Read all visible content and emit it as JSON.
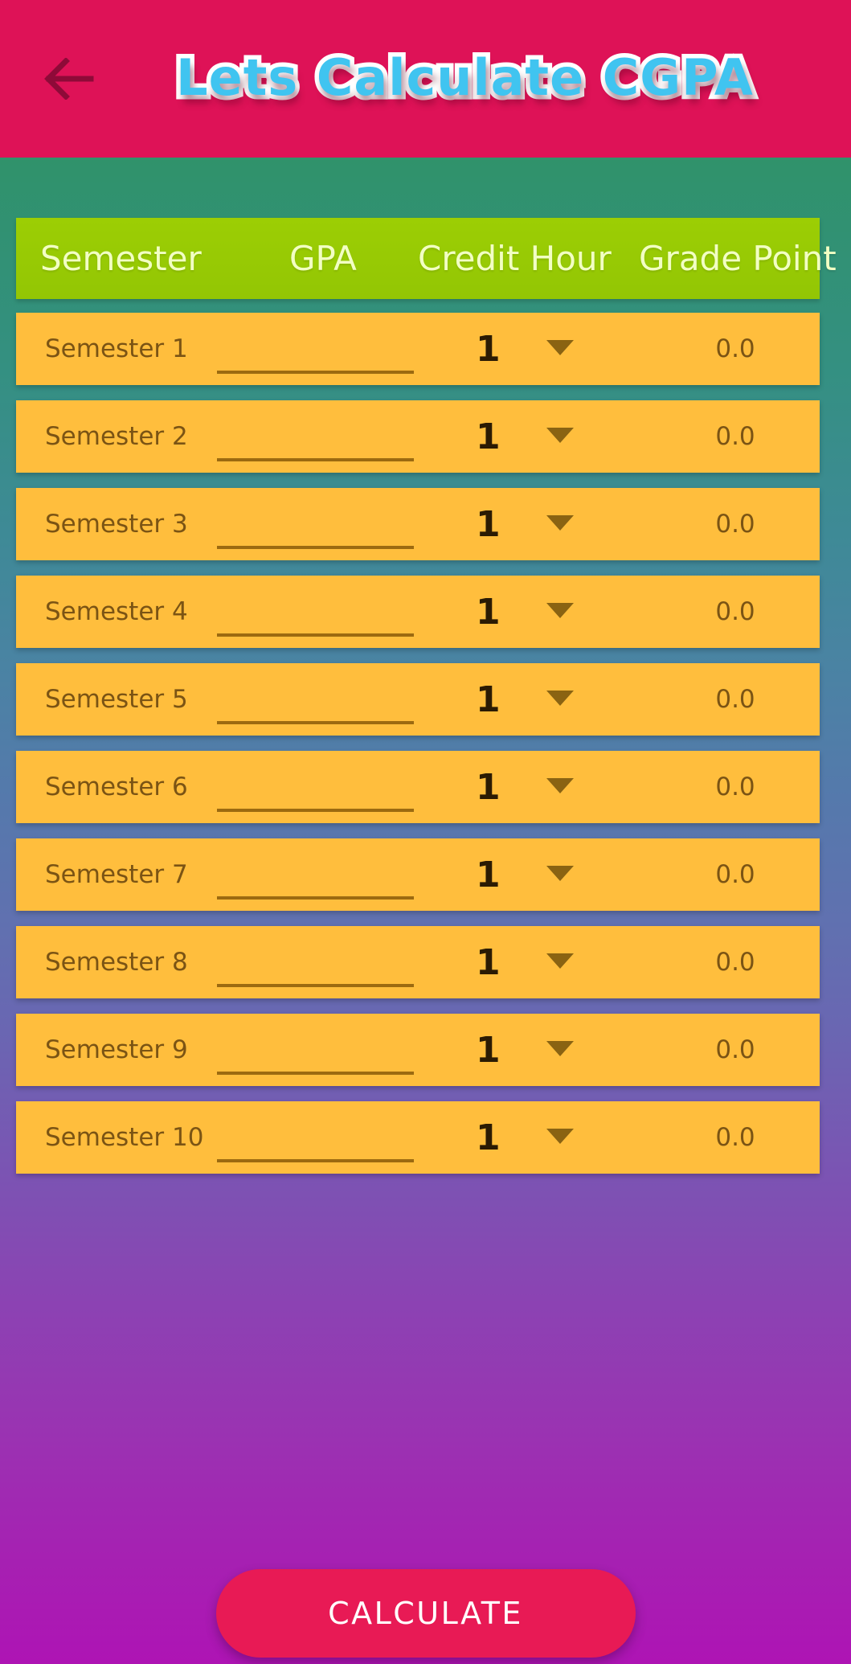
{
  "appbar": {
    "back_icon": "back-arrow-icon",
    "title": "Lets Calculate CGPA",
    "background_color": "#DE1257",
    "title_color": "#40C4F0",
    "title_outline_color": "#FFFFFF"
  },
  "table": {
    "header_background_color": "#9CCE04",
    "header_text_color": "#F2FFC4",
    "row_background_color": "#FFBE3D",
    "columns": [
      {
        "key": "semester",
        "label": "Semester"
      },
      {
        "key": "gpa",
        "label": "GPA"
      },
      {
        "key": "credit_hour",
        "label": "Credit Hour"
      },
      {
        "key": "grade_point",
        "label": "Grade Point"
      }
    ],
    "rows": [
      {
        "semester": "Semester 1",
        "gpa_value": "",
        "gpa_placeholder": "",
        "credit_hour": "1",
        "grade_point": "0.0"
      },
      {
        "semester": "Semester 2",
        "gpa_value": "",
        "gpa_placeholder": "",
        "credit_hour": "1",
        "grade_point": "0.0"
      },
      {
        "semester": "Semester 3",
        "gpa_value": "",
        "gpa_placeholder": "",
        "credit_hour": "1",
        "grade_point": "0.0"
      },
      {
        "semester": "Semester 4",
        "gpa_value": "",
        "gpa_placeholder": "",
        "credit_hour": "1",
        "grade_point": "0.0"
      },
      {
        "semester": "Semester 5",
        "gpa_value": "",
        "gpa_placeholder": "",
        "credit_hour": "1",
        "grade_point": "0.0"
      },
      {
        "semester": "Semester 6",
        "gpa_value": "",
        "gpa_placeholder": "",
        "credit_hour": "1",
        "grade_point": "0.0"
      },
      {
        "semester": "Semester 7",
        "gpa_value": "",
        "gpa_placeholder": "",
        "credit_hour": "1",
        "grade_point": "0.0"
      },
      {
        "semester": "Semester 8",
        "gpa_value": "",
        "gpa_placeholder": "",
        "credit_hour": "1",
        "grade_point": "0.0"
      },
      {
        "semester": "Semester 9",
        "gpa_value": "",
        "gpa_placeholder": "",
        "credit_hour": "1",
        "grade_point": "0.0"
      },
      {
        "semester": "Semester 10",
        "gpa_value": "",
        "gpa_placeholder": "",
        "credit_hour": "1",
        "grade_point": "0.0"
      }
    ],
    "credit_hour_caret_icon": "chevron-down-icon"
  },
  "footer": {
    "calculate_label": "CALCULATE",
    "calculate_color": "#E81A55"
  },
  "background": {
    "gradient_start": "#2E9268",
    "gradient_mid": "#6170B0",
    "gradient_end": "#AE14B4"
  }
}
